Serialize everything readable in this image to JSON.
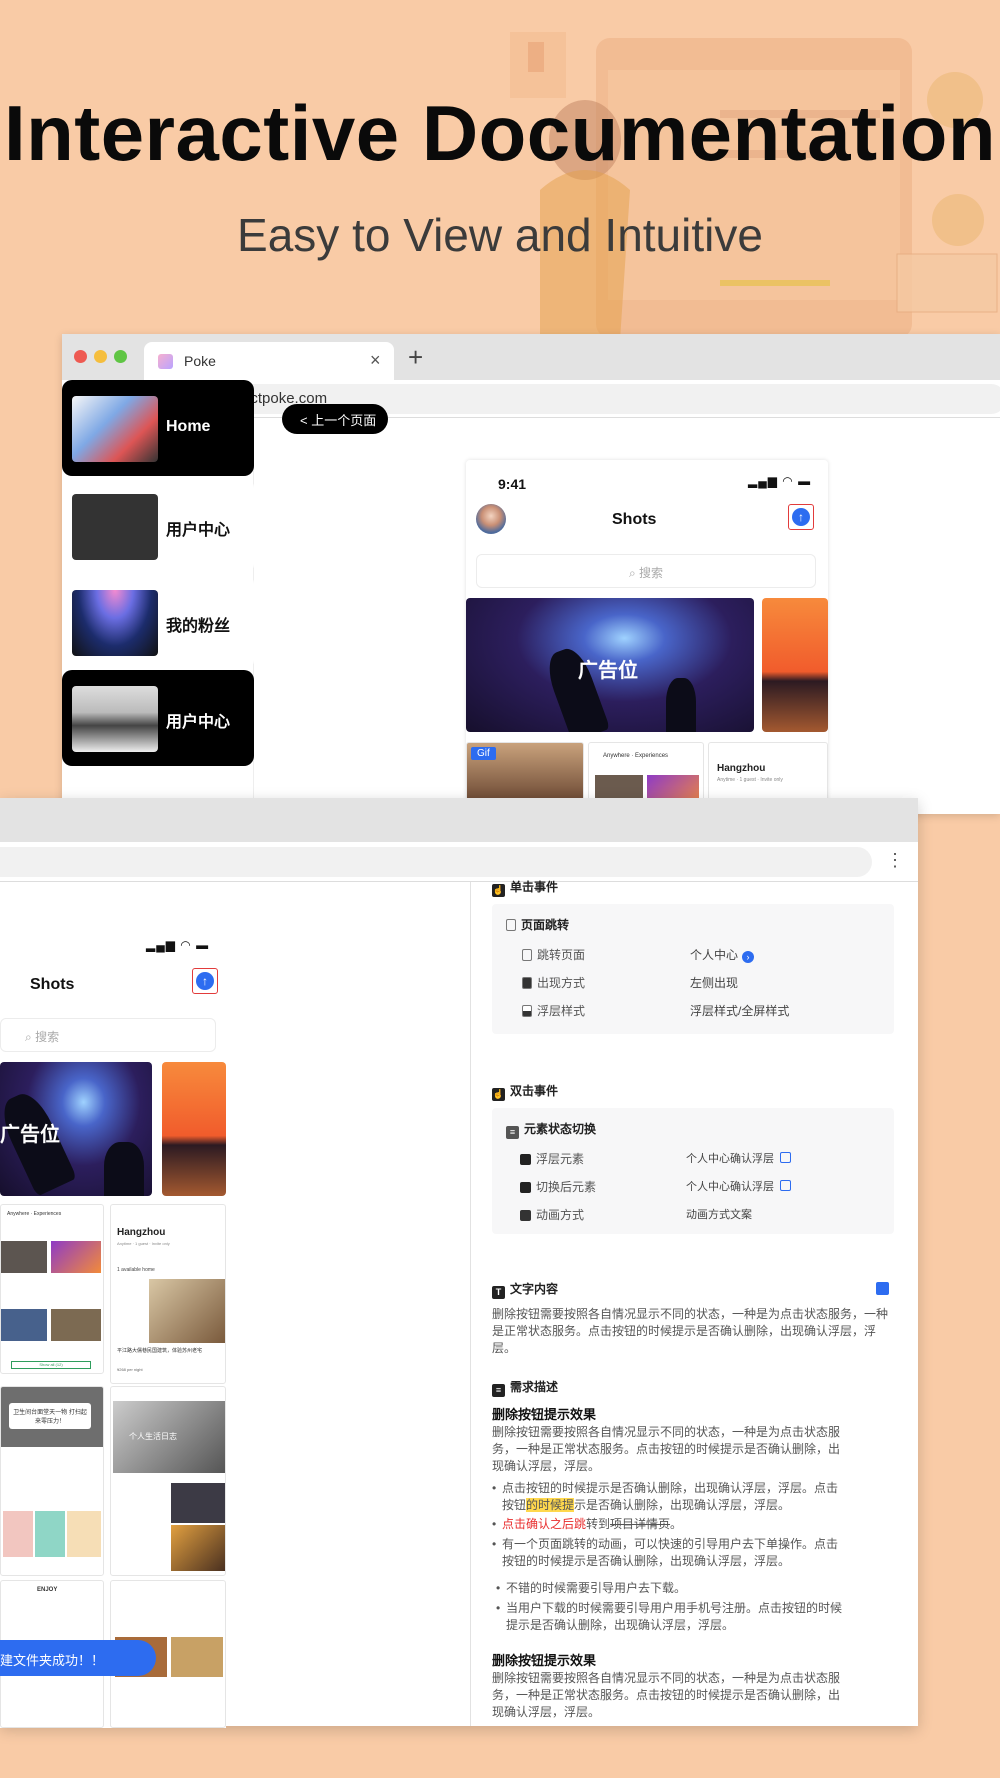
{
  "hero": {
    "title": "Interactive Documentation",
    "subtitle": "Easy to View and Intuitive"
  },
  "colors": {
    "background": "#f9cba6",
    "accent_blue": "#2d6cf0",
    "alert_red": "#e82d2d",
    "sidebar_active": "#000000"
  },
  "browser_back": {
    "tab_title": "Poke",
    "tab_close": "×",
    "new_tab": "+",
    "url": "productpoke.com",
    "nav_icons": [
      "back-icon",
      "forward-icon",
      "reload-icon",
      "lock-icon"
    ],
    "sidebar": [
      {
        "label": "Home",
        "active": true
      },
      {
        "label": "用户中心",
        "active": false
      },
      {
        "label": "我的粉丝",
        "active": false
      },
      {
        "label": "用户中心",
        "active": true
      }
    ],
    "prev_page_button": "< 上一个页面",
    "phone": {
      "time": "9:41",
      "title": "Shots",
      "search_placeholder": "搜索",
      "ad_label": "广告位",
      "gif_badge": "Gif",
      "mini_city": "Hangzhou",
      "mini_sub": "Anytime · 1 guest · Invite only",
      "mini_header": "Anywhere · Experiences"
    }
  },
  "browser_front": {
    "more_icon": "more-vertical-icon",
    "phone": {
      "title": "Shots",
      "search_placeholder": "搜索",
      "ad_label": "广告位",
      "mini_city": "Hangzhou",
      "mini_sub": "Anytime · 1 guest · Invite only",
      "mini_avail": "1 available home",
      "mini_card": "平江路大儒巷民国建筑，体验苏州老宅",
      "mini_price": "¥268 per night",
      "mini_show": "Show all (12)",
      "mini_banner": "卫生间台面堂天一物 打扫起来零压力！",
      "mini_note": "个人生活日志"
    },
    "single_click": {
      "header": "单击事件",
      "group": "页面跳转",
      "rows": [
        {
          "label": "跳转页面",
          "value": "个人中心"
        },
        {
          "label": "出现方式",
          "value": "左侧出现"
        },
        {
          "label": "浮层样式",
          "value": "浮层样式/全屏样式"
        }
      ]
    },
    "double_click": {
      "header": "双击事件",
      "group": "元素状态切换",
      "rows": [
        {
          "label": "浮层元素",
          "value": "个人中心确认浮层"
        },
        {
          "label": "切换后元素",
          "value": "个人中心确认浮层"
        },
        {
          "label": "动画方式",
          "value": "动画方式文案"
        }
      ]
    },
    "text_content": {
      "header": "文字内容",
      "body": "删除按钮需要按照各自情况显示不同的状态，一种是为点击状态服务，一种是正常状态服务。点击按钮的时候提示是否确认删除，出现确认浮层，浮层。"
    },
    "requirement": {
      "header": "需求描述",
      "title1": "删除按钮提示效果",
      "para1": "删除按钮需要按照各自情况显示不同的状态，一种是为点击状态服务，一种是正常状态服务。点击按钮的时候提示是否确认删除，出现确认浮层，浮层。",
      "b1a": "点击按钮的时候提示是否确认删除，出现确认浮层，浮层。点击按钮",
      "b1hl": "的时候提",
      "b1b": "示是否确认删除，出现确认浮层，浮层。",
      "b2red": "点击确认之后跳",
      "b2a": "转到",
      "b2strike": "项目详情页",
      "b2b": "。",
      "b3": "有一个页面跳转的动画，可以快速的引导用户去下单操作。点击按钮的时候提示是否确认删除，出现确认浮层，浮层。",
      "b4": "不错的时候需要引导用户去下载。",
      "b5": "当用户下载的时候需要引导用户用手机号注册。点击按钮的时候提示是否确认删除，出现确认浮层，浮层。",
      "title2": "删除按钮提示效果",
      "para2": "删除按钮需要按照各自情况显示不同的状态，一种是为点击状态服务，一种是正常状态服务。点击按钮的时候提示是否确认删除，出现确认浮层，浮层。"
    },
    "toast": "建文件夹成功！！"
  }
}
